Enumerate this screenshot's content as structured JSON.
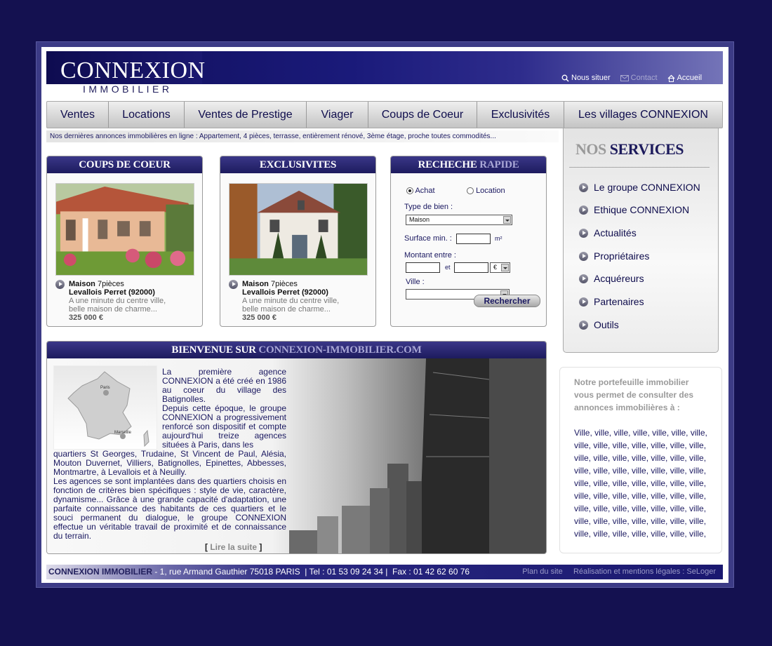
{
  "brand": {
    "name": "CONNEXION",
    "sub": "IMMOBILIER"
  },
  "toplinks": {
    "locate": "Nous situer",
    "contact": "Contact",
    "home": "Accueil"
  },
  "nav": [
    "Ventes",
    "Locations",
    "Ventes de Prestige",
    "Viager",
    "Coups de Coeur",
    "Exclusivités",
    "Les villages CONNEXION"
  ],
  "ticker": "Nos dernières annonces immobilières en ligne : Appartement, 4 pièces, terrasse, entièrement rénové, 3ème étage, proche toutes commodités...",
  "coups": {
    "title": "COUPS DE COEUR",
    "type": "Maison",
    "rooms": "7pièces",
    "city": "Levallois Perret (92000)",
    "desc1": "A une minute du centre ville,",
    "desc2": "belle maison de charme...",
    "price": "325 000 €"
  },
  "exclu": {
    "title": "EXCLUSIVITES",
    "type": "Maison",
    "rooms": "7pièces",
    "city": "Levallois Perret (92000)",
    "desc1": "A une minute du centre ville,",
    "desc2": "belle maison de charme...",
    "price": "325 000 €"
  },
  "search": {
    "title_a": "RECHECHE",
    "title_b": "RAPIDE",
    "achat": "Achat",
    "location": "Location",
    "type_label": "Type de bien :",
    "type_value": "Maison",
    "surface_label": "Surface min. :",
    "surface_unit": "m²",
    "montant_label": "Montant entre :",
    "et": "et",
    "currency": "€",
    "ville_label": "Ville :",
    "button": "Rechercher"
  },
  "welcome": {
    "title_a": "BIENVENUE SUR",
    "title_b": "CONNEXION-IMMOBILIER.COM",
    "map_paris": "Paris",
    "map_marseille": "Marseille",
    "p1": "La première agence CONNEXION a été créé en 1986 au coeur du village des Batignolles.",
    "p2": "Depuis cette époque, le groupe CONNEXION a progressivement renforcé son dispositif et compte aujourd'hui treize agences situées à Paris, dans les",
    "p3": "quartiers St Georges, Trudaine, St Vincent de Paul, Alésia, Mouton Duvernet, Villiers, Batignolles, Epinettes, Abbesses, Montmartre, à Levallois et à Neuilly.",
    "p4": "Les agences se sont implantées dans des quartiers choisis en fonction de critères bien spécifiques : style de vie, caractère, dynamisme... Grâce à une grande capacité d'adaptation, une parfaite connaissance des habitants de ces quartiers et le souci permanent du dialogue, le groupe CONNEXION effectue un véritable travail de proximité et de connaissance du terrain.",
    "more_open": "[",
    "more": "Lire la suite",
    "more_close": "]"
  },
  "services": {
    "title_a": "NOS",
    "title_b": "SERVICES",
    "items": [
      "Le groupe CONNEXION",
      "Ethique CONNEXION",
      "Actualités",
      "Propriétaires",
      "Acquéreurs",
      "Partenaires",
      "Outils"
    ]
  },
  "portfolio": {
    "intro": "Notre portefeuille immobilier vous permet de consulter des annonces immobilières à :",
    "villes": "Ville, ville, ville, ville, ville, ville, ville, ville, ville, ville, ville, ville, ville, ville, ville, ville, ville, ville, ville, ville, ville, ville, ville, ville, ville, ville, ville, ville, ville, ville, ville, ville, ville, ville, ville, ville, ville, ville, ville, ville, ville, ville, ville, ville, ville, ville, ville, ville, ville, ville, ville, ville, ville, ville, ville, ville, ville, ville, ville, ville, ville, ville, ville,"
  },
  "footer": {
    "company": "CONNEXION IMMOBILIER",
    "address": " - 1, rue Armand Gauthier 75018 PARIS  | Tel : 01 53 09 24 34 |  Fax : 01 42 62 60 76",
    "plan": "Plan du site",
    "legal": "Réalisation et mentions légales : SeLoger"
  }
}
